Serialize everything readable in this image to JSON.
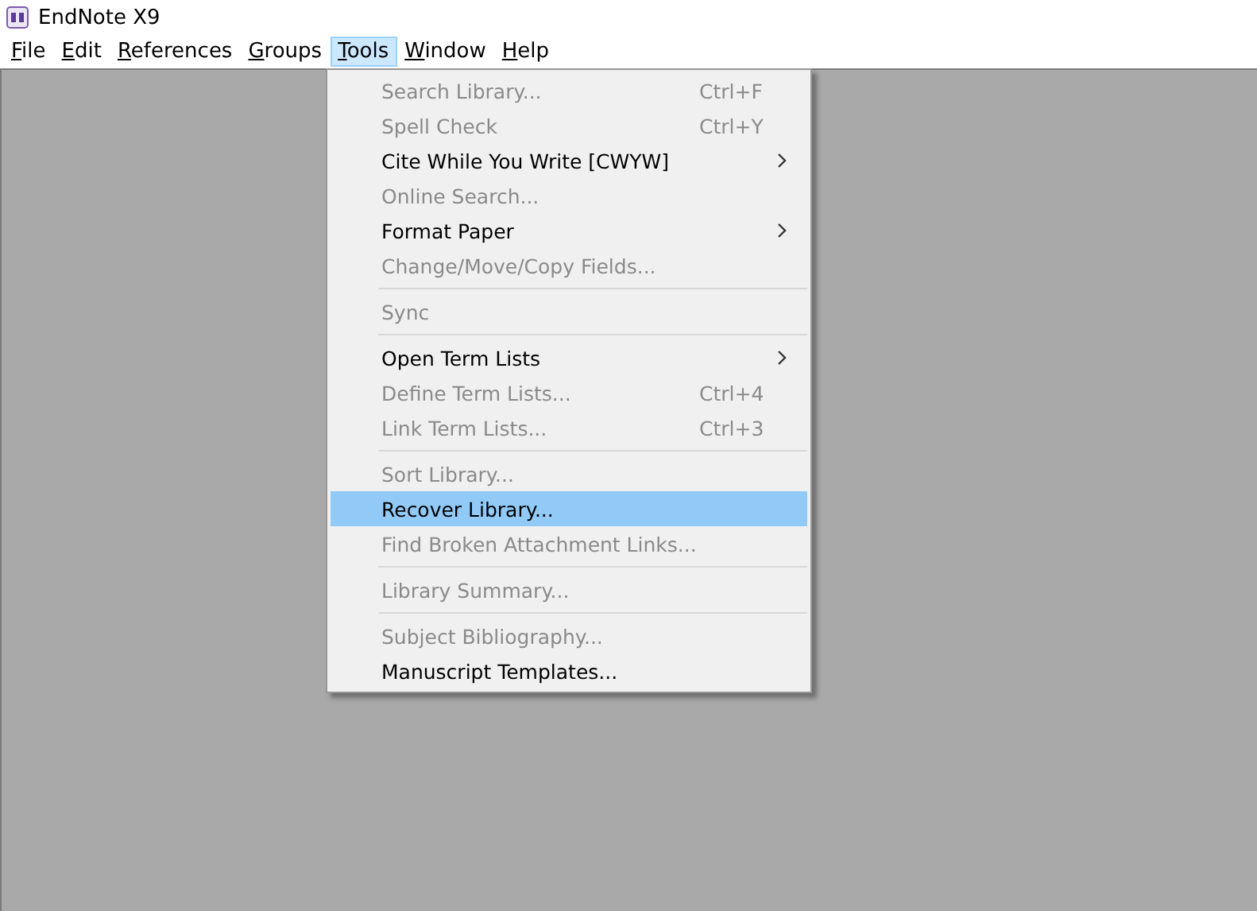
{
  "window": {
    "title": "EndNote X9"
  },
  "menubar": [
    {
      "label": "File",
      "selected": false
    },
    {
      "label": "Edit",
      "selected": false
    },
    {
      "label": "References",
      "selected": false
    },
    {
      "label": "Groups",
      "selected": false
    },
    {
      "label": "Tools",
      "selected": true
    },
    {
      "label": "Window",
      "selected": false
    },
    {
      "label": "Help",
      "selected": false
    }
  ],
  "tools_menu": [
    {
      "kind": "item",
      "label": "Search Library...",
      "shortcut": "Ctrl+F",
      "disabled": true,
      "submenu": false,
      "selected": false
    },
    {
      "kind": "item",
      "label": "Spell Check",
      "shortcut": "Ctrl+Y",
      "disabled": true,
      "submenu": false,
      "selected": false
    },
    {
      "kind": "item",
      "label": "Cite While You Write [CWYW]",
      "disabled": false,
      "submenu": true,
      "selected": false
    },
    {
      "kind": "item",
      "label": "Online Search...",
      "disabled": true,
      "submenu": false,
      "selected": false
    },
    {
      "kind": "item",
      "label": "Format Paper",
      "disabled": false,
      "submenu": true,
      "selected": false
    },
    {
      "kind": "item",
      "label": "Change/Move/Copy Fields...",
      "disabled": true,
      "submenu": false,
      "selected": false
    },
    {
      "kind": "separator"
    },
    {
      "kind": "item",
      "label": "Sync",
      "disabled": true,
      "submenu": false,
      "selected": false
    },
    {
      "kind": "separator"
    },
    {
      "kind": "item",
      "label": "Open Term Lists",
      "disabled": false,
      "submenu": true,
      "selected": false
    },
    {
      "kind": "item",
      "label": "Define Term Lists...",
      "shortcut": "Ctrl+4",
      "disabled": true,
      "submenu": false,
      "selected": false
    },
    {
      "kind": "item",
      "label": "Link Term Lists...",
      "shortcut": "Ctrl+3",
      "disabled": true,
      "submenu": false,
      "selected": false
    },
    {
      "kind": "separator"
    },
    {
      "kind": "item",
      "label": "Sort Library...",
      "disabled": true,
      "submenu": false,
      "selected": false
    },
    {
      "kind": "item",
      "label": "Recover Library...",
      "disabled": false,
      "submenu": false,
      "selected": true
    },
    {
      "kind": "item",
      "label": "Find Broken Attachment Links...",
      "disabled": true,
      "submenu": false,
      "selected": false
    },
    {
      "kind": "separator"
    },
    {
      "kind": "item",
      "label": "Library Summary...",
      "disabled": true,
      "submenu": false,
      "selected": false
    },
    {
      "kind": "separator"
    },
    {
      "kind": "item",
      "label": "Subject Bibliography...",
      "disabled": true,
      "submenu": false,
      "selected": false
    },
    {
      "kind": "item",
      "label": "Manuscript Templates...",
      "disabled": false,
      "submenu": false,
      "selected": false
    }
  ]
}
